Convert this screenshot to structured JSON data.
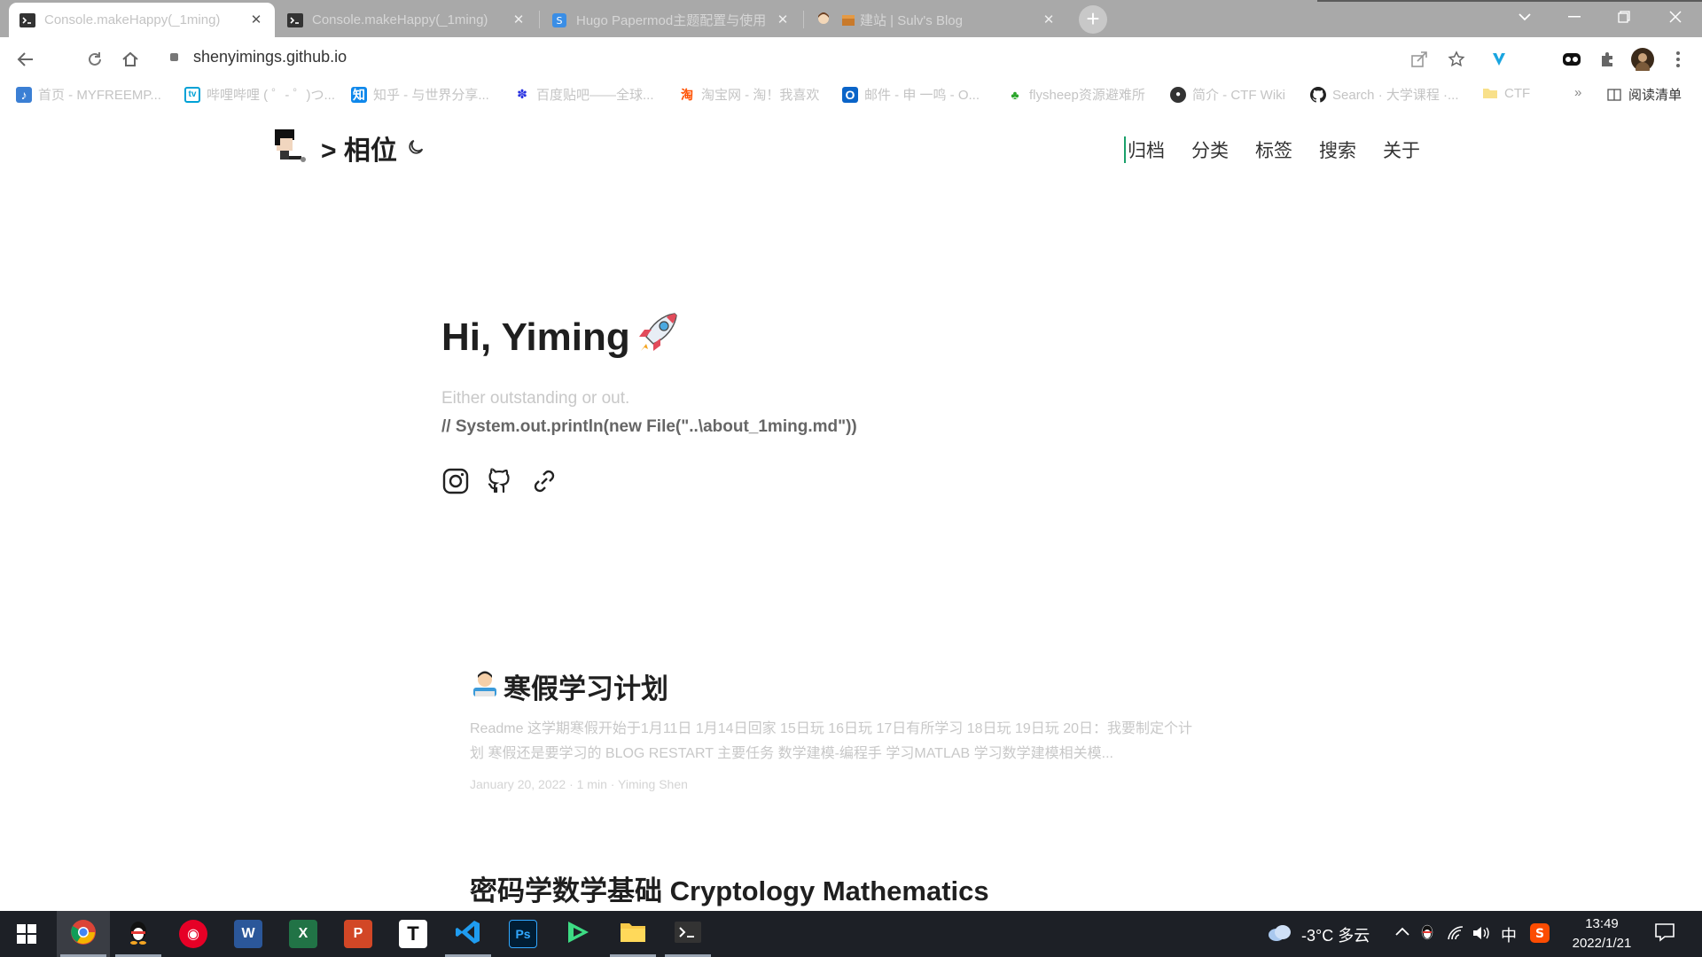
{
  "tabs": [
    {
      "title": "Console.makeHappy(_1ming)",
      "icon": "terminal-icon",
      "active": true
    },
    {
      "title": "Console.makeHappy(_1ming)",
      "icon": "terminal-icon",
      "active": false
    },
    {
      "title": "Hugo Papermod主题配置与使用",
      "icon": "blog-icon",
      "active": false
    },
    {
      "title": "建站 | Sulv's Blog",
      "icon": "avatar-icon",
      "active": false
    }
  ],
  "tab_close": "✕",
  "new_tab": "+",
  "address": {
    "url": "shenyimings.github.io"
  },
  "bookmarks": [
    {
      "label": "首页 - MYFREEMP...",
      "icon": "music-icon"
    },
    {
      "label": "哔哩哔哩 ( ゜- ゜)つ...",
      "icon": "bilibili-icon"
    },
    {
      "label": "知乎 - 与世界分享...",
      "icon": "zhihu-icon"
    },
    {
      "label": "百度贴吧——全球...",
      "icon": "baidu-icon"
    },
    {
      "label": "淘宝网 - 淘！我喜欢",
      "icon": "taobao-icon"
    },
    {
      "label": "邮件 - 申 一鸣 - O...",
      "icon": "outlook-icon"
    },
    {
      "label": "flysheep资源避难所",
      "icon": "tree-icon"
    },
    {
      "label": "简介 - CTF Wiki",
      "icon": "ctfwiki-icon"
    },
    {
      "label": "Search · 大学课程 ·...",
      "icon": "github-icon"
    },
    {
      "label": "CTF",
      "icon": "folder-icon"
    }
  ],
  "bookmarks_more": "»",
  "reading_list": "阅读清单",
  "site": {
    "logo_text": "> 相位",
    "nav": [
      "归档",
      "分类",
      "标签",
      "搜索",
      "关于"
    ]
  },
  "hero": {
    "title": "Hi, Yiming",
    "subtitle": "Either outstanding or out.",
    "code": "// System.out.println(new File(\"..\\about_1ming.md\"))"
  },
  "posts": [
    {
      "title": "寒假学习计划",
      "excerpt": "Readme 这学期寒假开始于1月11日 1月14日回家 15日玩 16日玩 17日有所学习 18日玩 19日玩 20日：我要制定个计划 寒假还是要学习的 BLOG RESTART 主要任务 数学建模-编程手 学习MATLAB 学习数学建模相关模...",
      "meta": "January 20, 2022 · 1 min · Yiming Shen"
    },
    {
      "title": "密码学数学基础 Cryptology Mathematics",
      "excerpt": "",
      "meta": ""
    }
  ],
  "taskbar": {
    "weather": "-3°C 多云",
    "ime": "中",
    "time": "13:49",
    "date": "2022/1/21"
  },
  "colors": {
    "tabstrip": "#a9a9a9",
    "taskbar": "#1d2026",
    "accent": "#2a7ae2"
  }
}
